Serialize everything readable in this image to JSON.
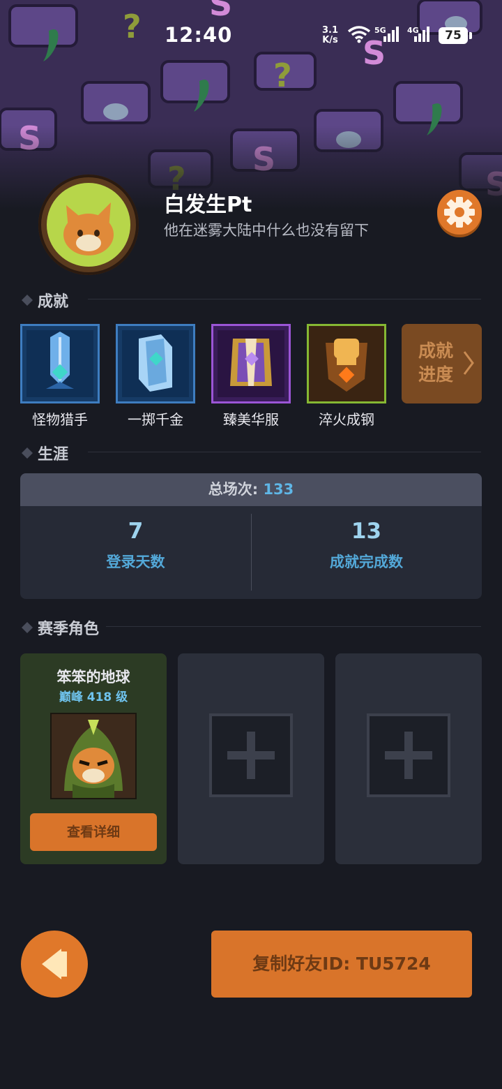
{
  "status_bar": {
    "time": "12:40",
    "net_speed_value": "3.1",
    "net_speed_unit": "K/s",
    "sim1_label": "5G",
    "sim2_label": "4G",
    "battery": "75"
  },
  "profile": {
    "name": "白发生Pt",
    "subtitle": "他在迷雾大陆中什么也没有留下"
  },
  "sections": {
    "achievements": "成就",
    "career": "生涯",
    "season_characters": "赛季角色"
  },
  "achievements": [
    {
      "label": "怪物猎手",
      "color": "#3e7dc0"
    },
    {
      "label": "一掷千金",
      "color": "#3e7dc0"
    },
    {
      "label": "臻美华服",
      "color": "#9b55d6"
    },
    {
      "label": "淬火成钢",
      "color": "#86b833"
    }
  ],
  "achievement_progress": {
    "line1": "成就",
    "line2": "进度"
  },
  "career": {
    "total_label": "总场次: ",
    "total_value": "133",
    "stats": [
      {
        "value": "7",
        "label": "登录天数"
      },
      {
        "value": "13",
        "label": "成就完成数"
      }
    ]
  },
  "season_cards": {
    "filled": {
      "name": "笨笨的地球",
      "level": "巅峰 418 级",
      "detail_button": "查看详细"
    }
  },
  "footer": {
    "copy_button": "复制好友ID: TU5724"
  },
  "colors": {
    "accent": "#e0782a",
    "stat_blue": "#53a8d8"
  }
}
